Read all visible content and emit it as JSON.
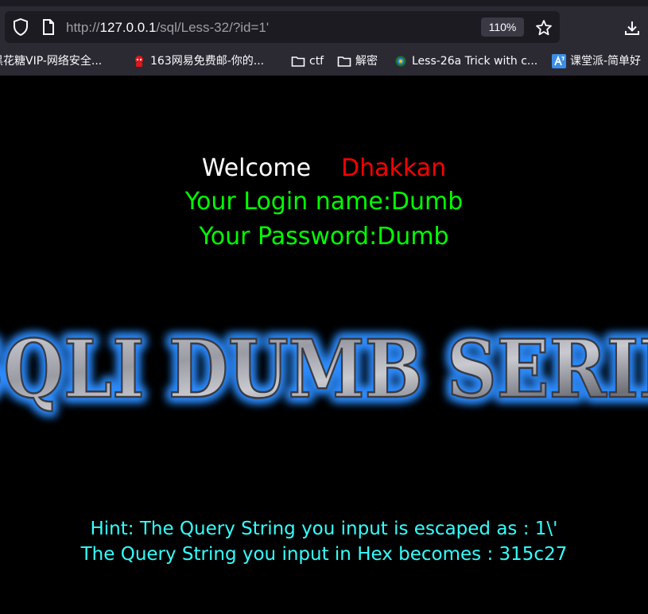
{
  "browser": {
    "url_prefix": "http://",
    "url_host": "127.0.0.1",
    "url_path": "/sql/Less-32/?id=1'",
    "zoom": "110%",
    "bookmarks": [
      {
        "icon": "flower-icon",
        "label": "黑花糖VIP-网络安全..."
      },
      {
        "icon": "mail-163-icon",
        "label": "163网易免费邮-你的..."
      },
      {
        "icon": "folder-icon",
        "label": "ctf"
      },
      {
        "icon": "folder-icon",
        "label": "解密"
      },
      {
        "icon": "peacock-icon",
        "label": "Less-26a Trick with c..."
      },
      {
        "icon": "ketangpai-icon",
        "label": "课堂派-简单好"
      }
    ]
  },
  "content": {
    "welcome_label": "Welcome",
    "username_display": "Dhakkan",
    "login_line": "Your Login name:Dumb",
    "password_line": "Your Password:Dumb",
    "banner_text": "SQLI DUMB SERIES",
    "hint_escaped": "Hint: The Query String you input is escaped as : 1\\'",
    "hint_hex": "The Query String you input in Hex becomes : 315c27"
  },
  "colors": {
    "welcome": "#ffffff",
    "username": "#ff0000",
    "credentials": "#00ff00",
    "hint": "#33ffff",
    "banner_glow": "#1e7bff"
  }
}
